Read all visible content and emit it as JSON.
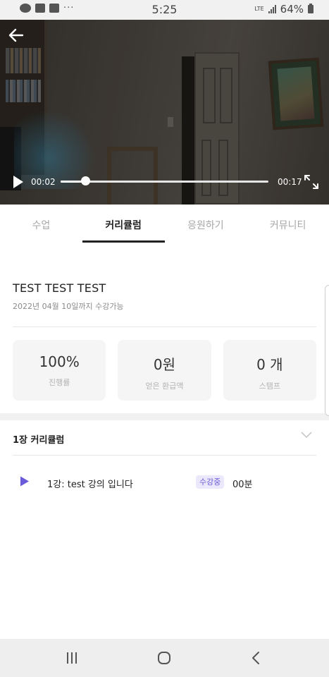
{
  "status_bar": {
    "time": "5:25",
    "network": "LTE",
    "battery": "64%",
    "more_dots": "···",
    "icons": [
      "talk-icon",
      "gallery-icon",
      "facebook-icon",
      "signal-icon",
      "battery-icon"
    ]
  },
  "player": {
    "current_time": "00:02",
    "total_time": "00:17",
    "progress": 0.12,
    "icons": [
      "back-arrow-icon",
      "play-icon",
      "fullscreen-icon"
    ]
  },
  "tabs": [
    {
      "label": "수업",
      "active": false
    },
    {
      "label": "커리큘럼",
      "active": true
    },
    {
      "label": "응원하기",
      "active": false
    },
    {
      "label": "커뮤니티",
      "active": false
    }
  ],
  "course": {
    "title": "TEST TEST TEST",
    "availability": "2022년 04월 10일까지 수강가능"
  },
  "stats": [
    {
      "value": "100%",
      "label": "진행률"
    },
    {
      "value": "0원",
      "label": "얻은 환급액"
    },
    {
      "value": "0 개",
      "label": "스탬프"
    }
  ],
  "curriculum": {
    "chapter_title": "1장 커리큘럼",
    "lessons": [
      {
        "title": "1강: test 강의 입니다",
        "badge": "수강중",
        "duration": "00분"
      }
    ]
  },
  "colors": {
    "accent": "#6a5bd8",
    "badge_bg": "#ebe8fb",
    "tab_inactive": "#a7a7a7"
  },
  "nav_bar": {
    "icons": [
      "recent-apps-icon",
      "home-icon",
      "back-icon"
    ]
  }
}
